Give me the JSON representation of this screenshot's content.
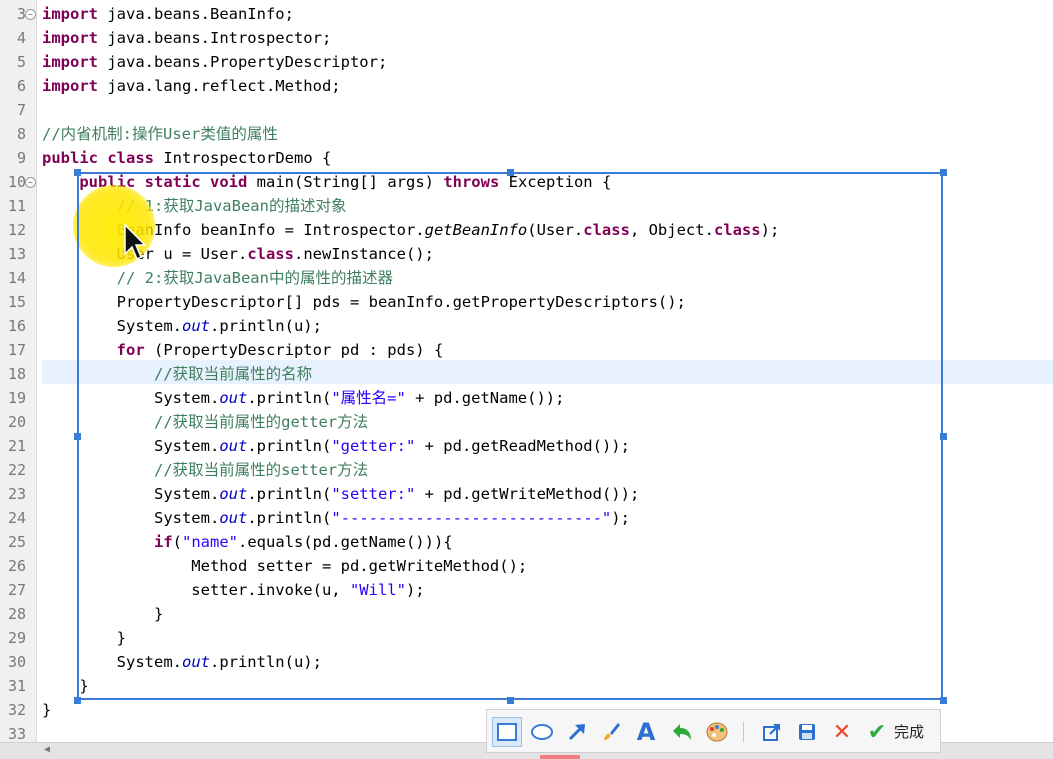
{
  "editor": {
    "line_numbers": [
      "3",
      "4",
      "5",
      "6",
      "7",
      "8",
      "9",
      "10",
      "11",
      "12",
      "13",
      "14",
      "15",
      "16",
      "17",
      "18",
      "19",
      "20",
      "21",
      "22",
      "23",
      "24",
      "25",
      "26",
      "27",
      "28",
      "29",
      "30",
      "31",
      "32",
      "33"
    ],
    "lines": [
      [
        {
          "c": "kw",
          "t": "import"
        },
        {
          "c": "",
          "t": " java.beans.BeanInfo;"
        }
      ],
      [
        {
          "c": "kw",
          "t": "import"
        },
        {
          "c": "",
          "t": " java.beans.Introspector;"
        }
      ],
      [
        {
          "c": "kw",
          "t": "import"
        },
        {
          "c": "",
          "t": " java.beans.PropertyDescriptor;"
        }
      ],
      [
        {
          "c": "kw",
          "t": "import"
        },
        {
          "c": "",
          "t": " java.lang.reflect.Method;"
        }
      ],
      [],
      [
        {
          "c": "cm",
          "t": "//内省机制:操作User类值的属性"
        }
      ],
      [
        {
          "c": "kw",
          "t": "public"
        },
        {
          "c": "",
          "t": " "
        },
        {
          "c": "kw",
          "t": "class"
        },
        {
          "c": "",
          "t": " IntrospectorDemo {"
        }
      ],
      [
        {
          "c": "",
          "t": "    "
        },
        {
          "c": "kw",
          "t": "public"
        },
        {
          "c": "",
          "t": " "
        },
        {
          "c": "kw",
          "t": "static"
        },
        {
          "c": "",
          "t": " "
        },
        {
          "c": "kw",
          "t": "void"
        },
        {
          "c": "",
          "t": " main(String[] args) "
        },
        {
          "c": "kw",
          "t": "throws"
        },
        {
          "c": "",
          "t": " Exception {"
        }
      ],
      [
        {
          "c": "",
          "t": "        "
        },
        {
          "c": "cm",
          "t": "// 1:获取JavaBean的描述对象"
        }
      ],
      [
        {
          "c": "",
          "t": "        BeanInfo beanInfo = Introspector."
        },
        {
          "c": "it",
          "t": "getBeanInfo"
        },
        {
          "c": "",
          "t": "(User."
        },
        {
          "c": "kw",
          "t": "class"
        },
        {
          "c": "",
          "t": ", Object."
        },
        {
          "c": "kw",
          "t": "class"
        },
        {
          "c": "",
          "t": ");"
        }
      ],
      [
        {
          "c": "",
          "t": "        User u = User."
        },
        {
          "c": "kw",
          "t": "class"
        },
        {
          "c": "",
          "t": ".newInstance();"
        }
      ],
      [
        {
          "c": "",
          "t": "        "
        },
        {
          "c": "cm",
          "t": "// 2:获取JavaBean中的属性的描述器"
        }
      ],
      [
        {
          "c": "",
          "t": "        PropertyDescriptor[] pds = beanInfo.getPropertyDescriptors();"
        }
      ],
      [
        {
          "c": "",
          "t": "        System."
        },
        {
          "c": "fi",
          "t": "out"
        },
        {
          "c": "",
          "t": ".println(u);"
        }
      ],
      [
        {
          "c": "",
          "t": "        "
        },
        {
          "c": "kw",
          "t": "for"
        },
        {
          "c": "",
          "t": " (PropertyDescriptor pd : pds) {"
        }
      ],
      [
        {
          "c": "",
          "t": "            "
        },
        {
          "c": "cm",
          "t": "//获取当前属性的名称"
        }
      ],
      [
        {
          "c": "",
          "t": "            System."
        },
        {
          "c": "fi",
          "t": "out"
        },
        {
          "c": "",
          "t": ".println("
        },
        {
          "c": "st",
          "t": "\"属性名=\""
        },
        {
          "c": "",
          "t": " + pd.getName());"
        }
      ],
      [
        {
          "c": "",
          "t": "            "
        },
        {
          "c": "cm",
          "t": "//获取当前属性的getter方法"
        }
      ],
      [
        {
          "c": "",
          "t": "            System."
        },
        {
          "c": "fi",
          "t": "out"
        },
        {
          "c": "",
          "t": ".println("
        },
        {
          "c": "st",
          "t": "\"getter:\""
        },
        {
          "c": "",
          "t": " + pd.getReadMethod());"
        }
      ],
      [
        {
          "c": "",
          "t": "            "
        },
        {
          "c": "cm",
          "t": "//获取当前属性的setter方法"
        }
      ],
      [
        {
          "c": "",
          "t": "            System."
        },
        {
          "c": "fi",
          "t": "out"
        },
        {
          "c": "",
          "t": ".println("
        },
        {
          "c": "st",
          "t": "\"setter:\""
        },
        {
          "c": "",
          "t": " + pd.getWriteMethod());"
        }
      ],
      [
        {
          "c": "",
          "t": "            System."
        },
        {
          "c": "fi",
          "t": "out"
        },
        {
          "c": "",
          "t": ".println("
        },
        {
          "c": "st",
          "t": "\"----------------------------\""
        },
        {
          "c": "",
          "t": ");"
        }
      ],
      [
        {
          "c": "",
          "t": "            "
        },
        {
          "c": "kw",
          "t": "if"
        },
        {
          "c": "",
          "t": "("
        },
        {
          "c": "st",
          "t": "\"name\""
        },
        {
          "c": "",
          "t": ".equals(pd.getName())){"
        }
      ],
      [
        {
          "c": "",
          "t": "                Method setter = pd.getWriteMethod();"
        }
      ],
      [
        {
          "c": "",
          "t": "                setter.invoke(u, "
        },
        {
          "c": "st",
          "t": "\"Will\""
        },
        {
          "c": "",
          "t": ");"
        }
      ],
      [
        {
          "c": "",
          "t": "            }"
        }
      ],
      [
        {
          "c": "",
          "t": "        }"
        }
      ],
      [
        {
          "c": "",
          "t": "        System."
        },
        {
          "c": "fi",
          "t": "out"
        },
        {
          "c": "",
          "t": ".println(u);"
        }
      ],
      [
        {
          "c": "",
          "t": "    }"
        }
      ],
      [
        {
          "c": "",
          "t": "}"
        }
      ],
      []
    ]
  },
  "capture_toolbar": {
    "tools": [
      {
        "icon": "rectangle-tool-icon",
        "active": true
      },
      {
        "icon": "ellipse-tool-icon"
      },
      {
        "icon": "arrow-tool-icon"
      },
      {
        "icon": "brush-tool-icon"
      },
      {
        "icon": "text-tool-icon",
        "glyph": "A"
      },
      {
        "icon": "undo-icon"
      },
      {
        "icon": "color-palette-icon"
      },
      {
        "icon": "share-icon"
      },
      {
        "icon": "save-icon"
      },
      {
        "icon": "cancel-icon",
        "glyph": "✕"
      },
      {
        "icon": "confirm-icon",
        "glyph": "✔"
      }
    ],
    "done_label": "完成",
    "colors": {
      "accent": "#3a7bd5",
      "cancel": "#e8452c",
      "confirm": "#2eaa3c",
      "brush": "#f5a623"
    }
  }
}
